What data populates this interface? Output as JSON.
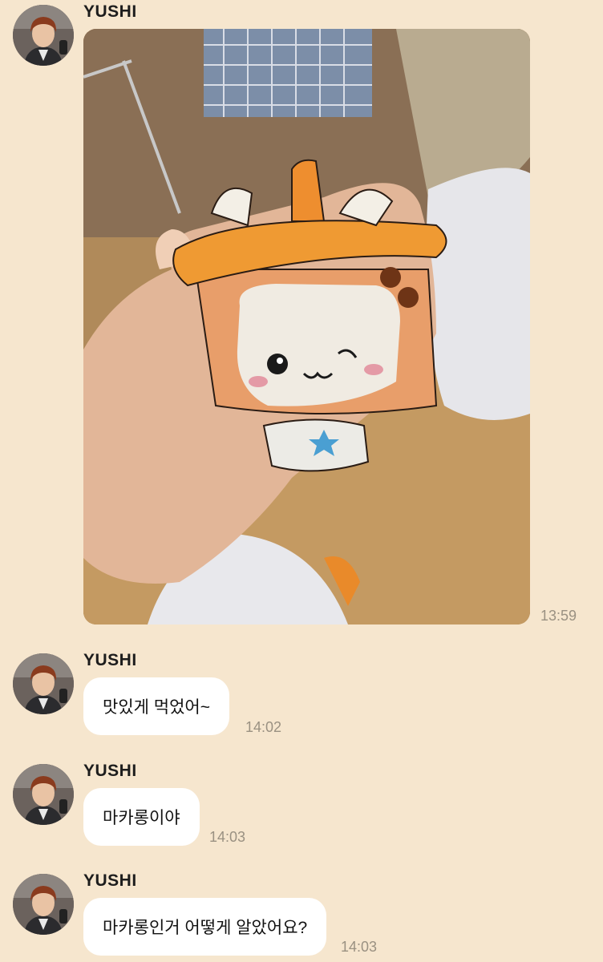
{
  "messages": [
    {
      "sender": "YUSHI",
      "type": "image",
      "time": "13:59"
    },
    {
      "sender": "YUSHI",
      "type": "text",
      "text": "맛있게 먹었어~",
      "time": "14:02"
    },
    {
      "sender": "YUSHI",
      "type": "text",
      "text": "마카롱이야",
      "time": "14:03"
    },
    {
      "sender": "YUSHI",
      "type": "text",
      "text": "마카롱인거 어떻게 알았어요?",
      "time": "14:03"
    }
  ],
  "colors": {
    "background": "#f6e6ce",
    "bubble": "#ffffff",
    "sender": "#1d1d1d",
    "timestamp": "#9a9182"
  },
  "icons": [
    "profile-avatar",
    "macaron-photo"
  ]
}
